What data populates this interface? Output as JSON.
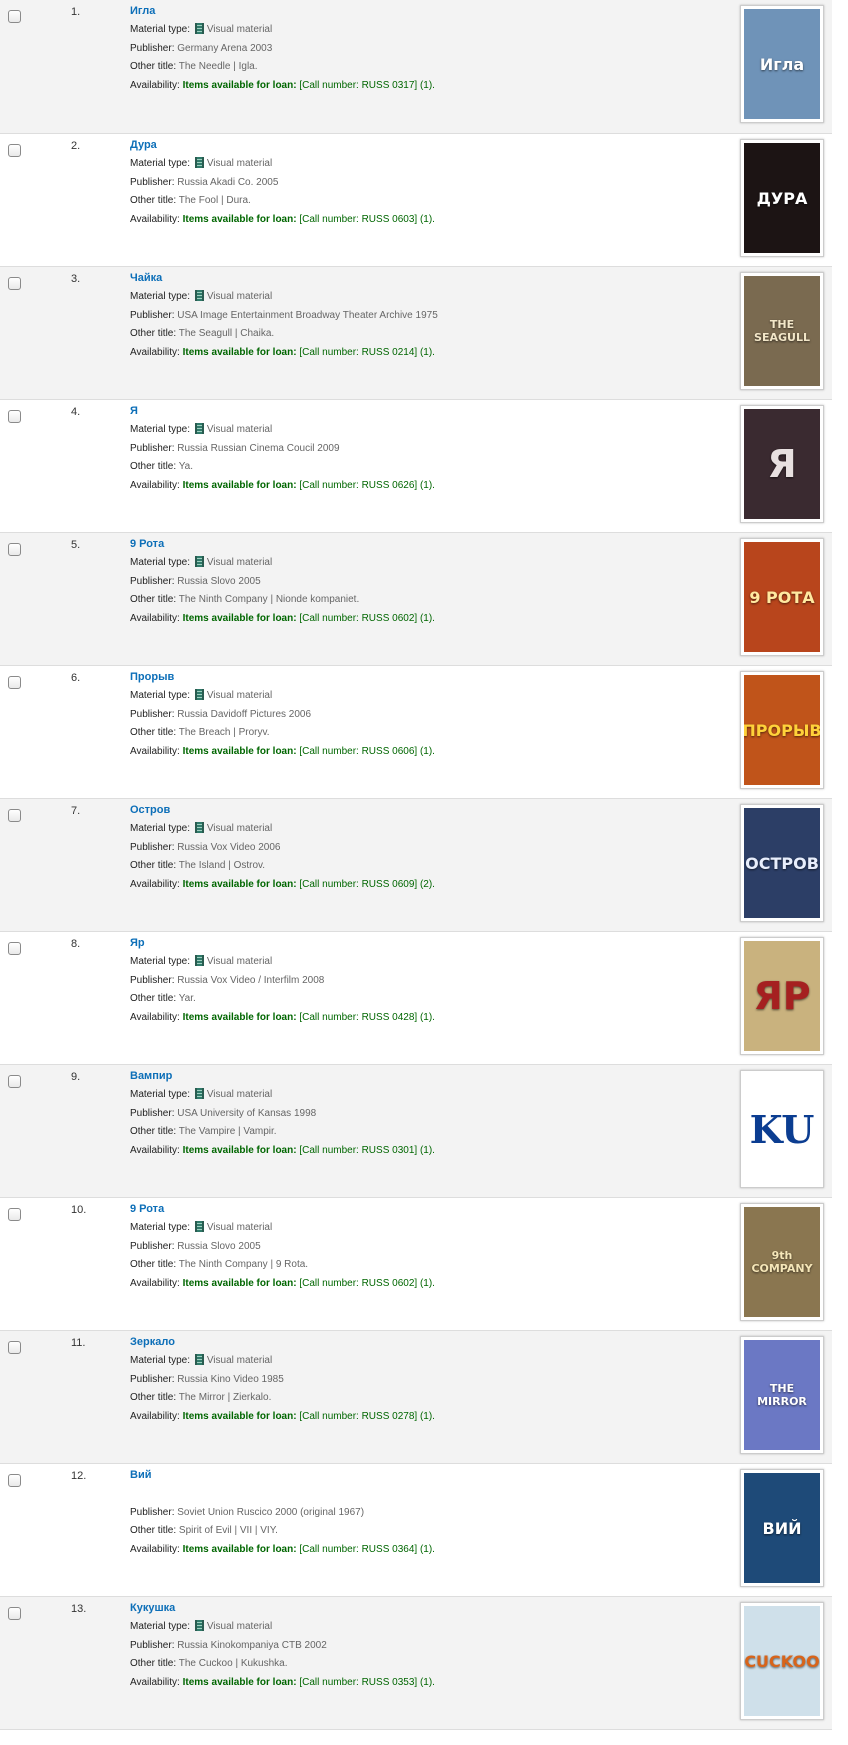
{
  "labels": {
    "material_type": "Material type:",
    "publisher": "Publisher:",
    "other_title": "Other title:",
    "availability": "Availability:",
    "items_available": "Items available for loan:"
  },
  "results": [
    {
      "num": "1.",
      "title": "Игла",
      "material": "Visual material",
      "publisher": "Germany Arena 2003",
      "other_title": "The Needle | Igla.",
      "call": "[Call number: RUSS 0317] (1).",
      "cover_text": "Игла",
      "cover_bg": "#6f93b8",
      "cover_fg": "#ffffff",
      "cover_icon": "needle-poster-icon"
    },
    {
      "num": "2.",
      "title": "Дура",
      "material": "Visual material",
      "publisher": "Russia Akadi Co. 2005",
      "other_title": "The Fool | Dura.",
      "call": "[Call number: RUSS 0603] (1).",
      "cover_text": "ДУРА",
      "cover_bg": "#1c1414",
      "cover_fg": "#ffffff",
      "cover_icon": "fool-poster-icon"
    },
    {
      "num": "3.",
      "title": "Чайка",
      "material": "Visual material",
      "publisher": "USA Image Entertainment Broadway Theater Archive 1975",
      "other_title": "The Seagull | Chaika.",
      "call": "[Call number: RUSS 0214] (1).",
      "cover_text": "THE SEAGULL",
      "cover_bg": "#7a6a50",
      "cover_fg": "#f2e6c8",
      "cover_icon": "seagull-poster-icon"
    },
    {
      "num": "4.",
      "title": "Я",
      "material": "Visual material",
      "publisher": "Russia Russian Cinema Coucil 2009",
      "other_title": "Ya.",
      "call": "[Call number: RUSS 0626] (1).",
      "cover_text": "Я",
      "cover_bg": "#3a2a30",
      "cover_fg": "#e8e0e0",
      "cover_icon": "ya-poster-icon"
    },
    {
      "num": "5.",
      "title": "9 Рота",
      "material": "Visual material",
      "publisher": "Russia Slovo 2005",
      "other_title": "The Ninth Company | Nionde kompaniet.",
      "call": "[Call number: RUSS 0602] (1).",
      "cover_text": "9 РОТА",
      "cover_bg": "#b8451c",
      "cover_fg": "#ffe9a0",
      "cover_icon": "ninth-company-poster-icon"
    },
    {
      "num": "6.",
      "title": "Прорыв",
      "material": "Visual material",
      "publisher": "Russia Davidoff Pictures 2006",
      "other_title": "The Breach | Proryv.",
      "call": "[Call number: RUSS 0606] (1).",
      "cover_text": "ПРОРЫВ",
      "cover_bg": "#c0541a",
      "cover_fg": "#ffd23a",
      "cover_icon": "breach-poster-icon"
    },
    {
      "num": "7.",
      "title": "Остров",
      "material": "Visual material",
      "publisher": "Russia Vox Video 2006",
      "other_title": "The Island | Ostrov.",
      "call": "[Call number: RUSS 0609] (2).",
      "cover_text": "ОСТРОВ",
      "cover_bg": "#2c3e66",
      "cover_fg": "#e8eefc",
      "cover_icon": "island-poster-icon"
    },
    {
      "num": "8.",
      "title": "Яр",
      "material": "Visual material",
      "publisher": "Russia Vox Video / Interfilm 2008",
      "other_title": "Yar.",
      "call": "[Call number: RUSS 0428] (1).",
      "cover_text": "ЯР",
      "cover_bg": "#c9b27e",
      "cover_fg": "#a52020",
      "cover_icon": "yar-poster-icon"
    },
    {
      "num": "9.",
      "title": "Вампир",
      "material": "Visual material",
      "publisher": "USA University of Kansas 1998",
      "other_title": "The Vampire | Vampir.",
      "call": "[Call number: RUSS 0301] (1).",
      "cover_text": "KU",
      "cover_bg": "#ffffff",
      "cover_fg": "#0b3d91",
      "cover_icon": "ku-logo-icon"
    },
    {
      "num": "10.",
      "title": "9 Рота",
      "material": "Visual material",
      "publisher": "Russia Slovo 2005",
      "other_title": "The Ninth Company | 9 Rota.",
      "call": "[Call number: RUSS 0602] (1).",
      "cover_text": "9th COMPANY",
      "cover_bg": "#8a7650",
      "cover_fg": "#f5e6b8",
      "cover_icon": "ninth-company-poster-icon"
    },
    {
      "num": "11.",
      "title": "Зеркало",
      "material": "Visual material",
      "publisher": "Russia Kino Video 1985",
      "other_title": "The Mirror | Zierkalo.",
      "call": "[Call number: RUSS 0278] (1).",
      "cover_text": "THE MIRROR",
      "cover_bg": "#6b78c4",
      "cover_fg": "#ffffff",
      "cover_icon": "mirror-poster-icon"
    },
    {
      "num": "12.",
      "title": "Вий",
      "material": "",
      "publisher": "Soviet Union Ruscico 2000 (original 1967)",
      "other_title": "Spirit of Evil | VII | VIY.",
      "call": "[Call number: RUSS 0364] (1).",
      "cover_text": "ВИЙ",
      "cover_bg": "#1e4a78",
      "cover_fg": "#ffffff",
      "cover_icon": "viy-poster-icon"
    },
    {
      "num": "13.",
      "title": "Кукушка",
      "material": "Visual material",
      "publisher": "Russia Kinokompaniya CTB 2002",
      "other_title": "The Cuckoo | Kukushka.",
      "call": "[Call number: RUSS 0353] (1).",
      "cover_text": "CUCKOO",
      "cover_bg": "#cfe0ea",
      "cover_fg": "#d8641a",
      "cover_icon": "cuckoo-poster-icon"
    }
  ]
}
